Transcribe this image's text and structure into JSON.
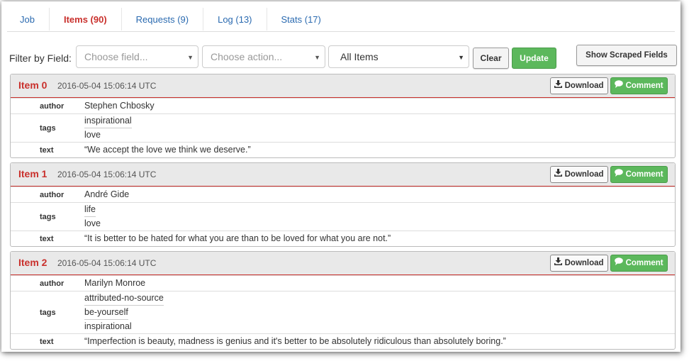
{
  "tabs": [
    {
      "label": "Job",
      "active": false
    },
    {
      "label": "Items (90)",
      "active": true
    },
    {
      "label": "Requests (9)",
      "active": false
    },
    {
      "label": "Log (13)",
      "active": false
    },
    {
      "label": "Stats (17)",
      "active": false
    }
  ],
  "filter": {
    "label": "Filter by Field:",
    "field_placeholder": "Choose field...",
    "action_placeholder": "Choose action...",
    "scope_value": "All Items",
    "clear_label": "Clear",
    "update_label": "Update",
    "show_fields_label": "Show Scraped Fields"
  },
  "item_buttons": {
    "download": "Download",
    "comment": "Comment"
  },
  "field_keys": {
    "author": "author",
    "tags": "tags",
    "text": "text"
  },
  "items": [
    {
      "title": "Item 0",
      "timestamp": "2016-05-04 15:06:14 UTC",
      "author": "Stephen Chbosky",
      "tags": [
        "inspirational",
        "love"
      ],
      "text": "“We accept the love we think we deserve.”"
    },
    {
      "title": "Item 1",
      "timestamp": "2016-05-04 15:06:14 UTC",
      "author": "André Gide",
      "tags": [
        "life",
        "love"
      ],
      "text": "“It is better to be hated for what you are than to be loved for what you are not.”"
    },
    {
      "title": "Item 2",
      "timestamp": "2016-05-04 15:06:14 UTC",
      "author": "Marilyn Monroe",
      "tags": [
        "attributed-no-source",
        "be-yourself",
        "inspirational"
      ],
      "text": "“Imperfection is beauty, madness is genius and it's better to be absolutely ridiculous than absolutely boring.”"
    }
  ],
  "colors": {
    "accent_red": "#c9302c",
    "link_blue": "#2a6ab0",
    "success_green": "#5cb85c"
  }
}
